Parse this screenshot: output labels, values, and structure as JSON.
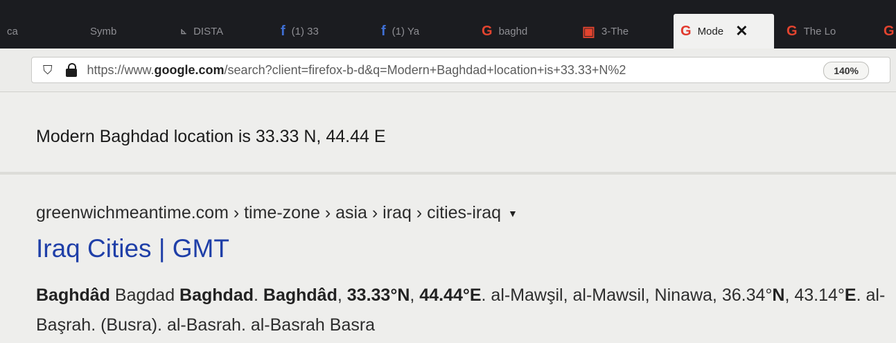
{
  "tabs": [
    {
      "icon": "",
      "label": "ca"
    },
    {
      "icon": "",
      "label": "Symb"
    },
    {
      "icon": "",
      "label": "DISTA"
    },
    {
      "icon": "f",
      "label": "(1) 33"
    },
    {
      "icon": "f",
      "label": "(1) Ya"
    },
    {
      "icon": "G",
      "label": "baghd"
    },
    {
      "icon": "▣",
      "label": "3-The"
    },
    {
      "icon": "G",
      "label": "Mode",
      "close": "✕"
    },
    {
      "icon": "G",
      "label": "The Lo"
    },
    {
      "icon": "G",
      "label": ""
    }
  ],
  "urlbar": {
    "shield_icon": "shield-icon",
    "url_prefix": "https://www.",
    "url_domain": "google.com",
    "url_rest": "/search?client=firefox-b-d&q=Modern+Baghdad+location+is+33.33+N%2",
    "zoom": "140%"
  },
  "featured": "Modern Baghdad location is 33.33 N, 44.44 E",
  "result": {
    "breadcrumb": "greenwichmeantime.com › time-zone › asia › iraq › cities-iraq",
    "caret": "▼",
    "title": "Iraq Cities | GMT",
    "snippet": {
      "s1": "Baghdâd",
      "s2": " Bagdad ",
      "s3": "Baghdad",
      "s4": ". ",
      "s5": "Baghdâd",
      "s6": ", ",
      "s7": "33.33°N",
      "s8": ", ",
      "s9": "44.44°E",
      "s10": ". al-Mawşil, al-Mawsil, Ninawa, 36.34°",
      "s11": "N",
      "s12": ", 43.14°",
      "s13": "E",
      "s14": ". al-Başrah. (Busra). al-Basrah. al-Basrah Basra"
    }
  }
}
